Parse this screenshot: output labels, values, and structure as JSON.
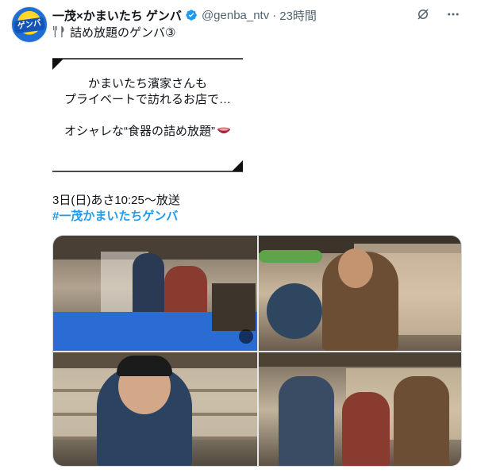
{
  "account": {
    "display_name": "一茂×かまいたち ゲンバ",
    "handle": "@genba_ntv",
    "separator": "·",
    "time": "23時間",
    "avatar_text": "ゲンバ"
  },
  "post": {
    "line1": "詰め放題のゲンバ③",
    "line2": "かまいたち濱家さんも",
    "line3": "プライベートで訪れるお店で…",
    "line4": "オシャレな“食器の詰め放題”",
    "line5": "3日(日)あさ10:25～放送",
    "hashtag": "#一茂かまいたちゲンバ"
  },
  "icons": {
    "verified": "verified-badge-icon",
    "grok": "grok-icon",
    "more": "more-icon",
    "fork_knife": "fork-knife-emoji",
    "bowl": "bowl-emoji",
    "gif_badge": "alt-badge-icon"
  },
  "colors": {
    "accent": "#1d9bf0",
    "text": "#0f1419",
    "muted": "#536471"
  }
}
